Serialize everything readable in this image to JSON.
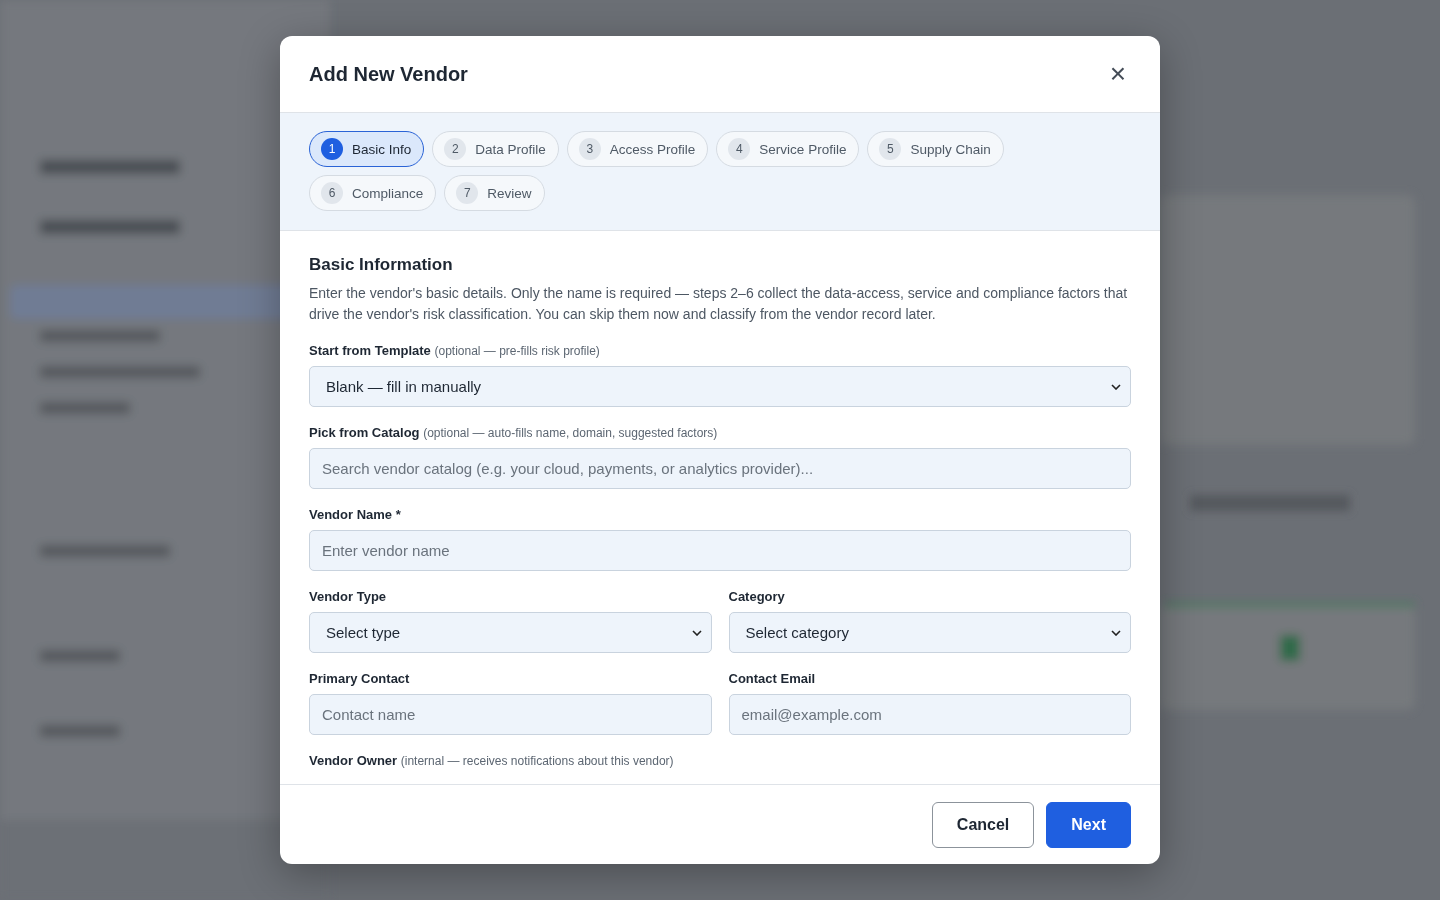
{
  "dialog": {
    "title": "Add New Vendor",
    "close_icon": "×"
  },
  "steps": [
    {
      "number": "1",
      "label": "Basic Info",
      "selected": true
    },
    {
      "number": "2",
      "label": "Data Profile",
      "selected": false
    },
    {
      "number": "3",
      "label": "Access Profile",
      "selected": false
    },
    {
      "number": "4",
      "label": "Service Profile",
      "selected": false
    },
    {
      "number": "5",
      "label": "Supply Chain",
      "selected": false
    },
    {
      "number": "6",
      "label": "Compliance",
      "selected": false
    },
    {
      "number": "7",
      "label": "Review",
      "selected": false
    }
  ],
  "section": {
    "title": "Basic Information",
    "description": "Enter the vendor's basic details. Only the name is required — steps 2–6 collect the data-access, service and compliance factors that drive the vendor's risk classification. You can skip them now and classify from the vendor record later."
  },
  "form_rows": [
    [
      {
        "kind": "select",
        "label": "Start from Template",
        "hint": "(optional — pre-fills risk profile)",
        "value": "Blank — fill in manually"
      }
    ],
    [
      {
        "kind": "input",
        "label": "Pick from Catalog",
        "hint": "(optional — auto-fills name, domain, suggested factors)",
        "placeholder": "Search vendor catalog (e.g. your cloud, payments, or analytics provider)..."
      }
    ],
    [
      {
        "kind": "input",
        "label": "Vendor Name *",
        "placeholder": "Enter vendor name"
      }
    ],
    [
      {
        "kind": "select",
        "label": "Vendor Type",
        "value": "Select type"
      },
      {
        "kind": "select",
        "label": "Category",
        "value": "Select category"
      }
    ],
    [
      {
        "kind": "input",
        "label": "Primary Contact",
        "placeholder": "Contact name"
      },
      {
        "kind": "input",
        "label": "Contact Email",
        "placeholder": "email@example.com"
      }
    ],
    [
      {
        "kind": "label",
        "label": "Vendor Owner",
        "hint": "(internal — receives notifications about this vendor)"
      }
    ]
  ],
  "buttons": [
    {
      "label": "Cancel",
      "kind": "secondary"
    },
    {
      "label": "Next",
      "kind": "primary"
    }
  ]
}
